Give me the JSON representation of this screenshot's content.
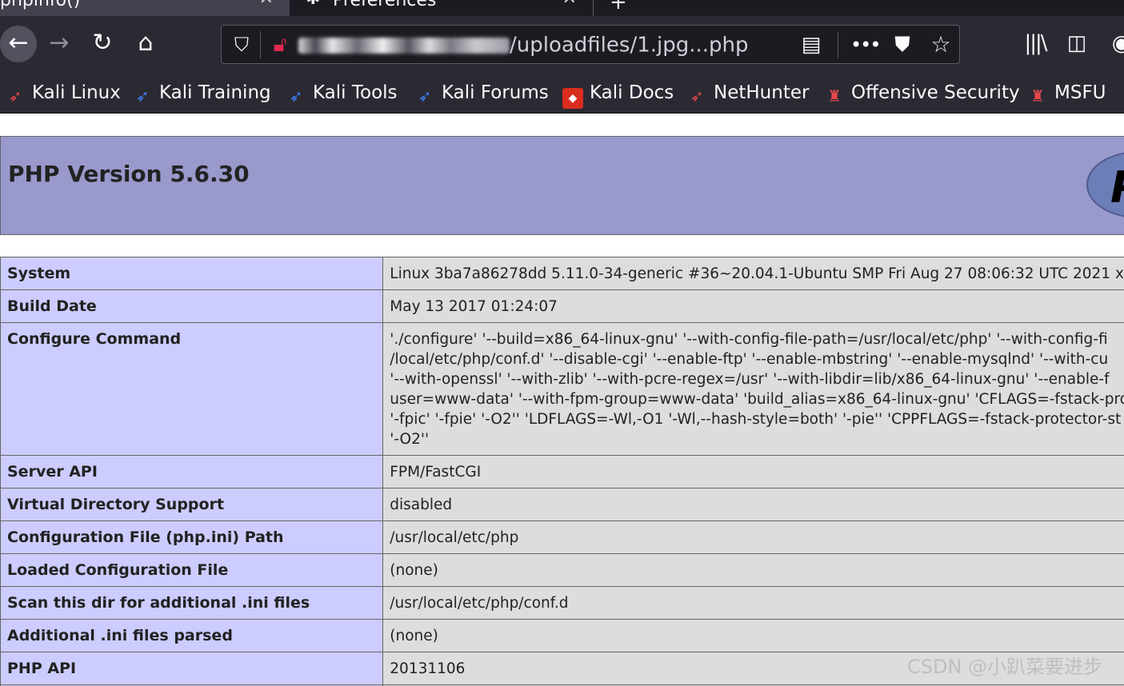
{
  "browser": {
    "tabs": [
      {
        "title": "phpinfo()",
        "active": true
      },
      {
        "title": "Preferences",
        "active": false
      }
    ],
    "url": {
      "visible_text": "/uploadfiles/1.jpg...php"
    },
    "bookmarks": [
      {
        "label": "Kali Linux",
        "icon": "kali-dragon-red-icon"
      },
      {
        "label": "Kali Training",
        "icon": "kali-dragon-icon"
      },
      {
        "label": "Kali Tools",
        "icon": "kali-dragon-icon"
      },
      {
        "label": "Kali Forums",
        "icon": "kali-dragon-icon"
      },
      {
        "label": "Kali Docs",
        "icon": "kali-docs-icon"
      },
      {
        "label": "NetHunter",
        "icon": "nethunter-icon"
      },
      {
        "label": "Offensive Security",
        "icon": "offsec-icon"
      },
      {
        "label": "MSFU",
        "icon": "offsec-icon"
      }
    ],
    "colors": {
      "chrome": "#2b2a33",
      "tabstrip": "#1c1b22",
      "urlbar": "#1c1b22",
      "insecure": "#e22850"
    }
  },
  "phpinfo": {
    "version_title": "PHP Version 5.6.30",
    "logo_text": "P",
    "colors": {
      "header": "#9999cc",
      "key_cell": "#ccccff",
      "value_cell": "#dddddd"
    },
    "rows": [
      {
        "key": "System",
        "value": [
          "Linux 3ba7a86278dd 5.11.0-34-generic #36~20.04.1-Ubuntu SMP Fri Aug 27 08:06:32 UTC 2021 x"
        ]
      },
      {
        "key": "Build Date",
        "value": [
          "May 13 2017 01:24:07"
        ]
      },
      {
        "key": "Configure Command",
        "value": [
          "'./configure' '--build=x86_64-linux-gnu' '--with-config-file-path=/usr/local/etc/php' '--with-config-fi",
          "/local/etc/php/conf.d' '--disable-cgi' '--enable-ftp' '--enable-mbstring' '--enable-mysqlnd' '--with-cu",
          "'--with-openssl' '--with-zlib' '--with-pcre-regex=/usr' '--with-libdir=lib/x86_64-linux-gnu' '--enable-f",
          "user=www-data' '--with-fpm-group=www-data' 'build_alias=x86_64-linux-gnu' 'CFLAGS=-fstack-pro",
          "'-fpic' '-fpie' '-O2'' 'LDFLAGS=-Wl,-O1 '-Wl,--hash-style=both' '-pie'' 'CPPFLAGS=-fstack-protector-st",
          "'-O2''"
        ]
      },
      {
        "key": "Server API",
        "value": [
          "FPM/FastCGI"
        ]
      },
      {
        "key": "Virtual Directory Support",
        "value": [
          "disabled"
        ]
      },
      {
        "key": "Configuration File (php.ini) Path",
        "value": [
          "/usr/local/etc/php"
        ]
      },
      {
        "key": "Loaded Configuration File",
        "value": [
          "(none)"
        ]
      },
      {
        "key": "Scan this dir for additional .ini files",
        "value": [
          "/usr/local/etc/php/conf.d"
        ]
      },
      {
        "key": "Additional .ini files parsed",
        "value": [
          "(none)"
        ]
      },
      {
        "key": "PHP API",
        "value": [
          "20131106"
        ]
      },
      {
        "key": "",
        "value": [
          ""
        ]
      }
    ]
  },
  "watermark": "CSDN @小趴菜要进步"
}
